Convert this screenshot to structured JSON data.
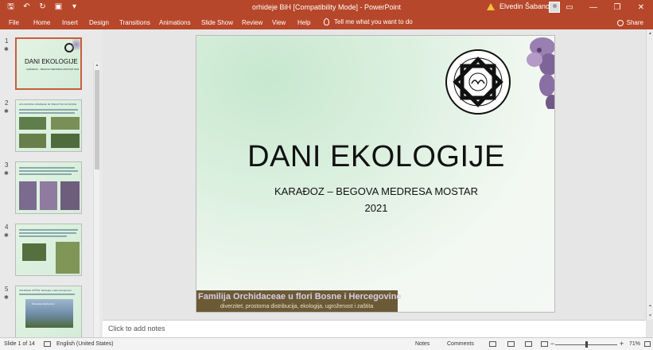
{
  "titlebar": {
    "doc_title": "orhideje BiH [Compatibility Mode]  -  PowerPoint",
    "user_name": "Elvedin Šabanović",
    "window_controls": {
      "minimize": "—",
      "restore": "❐",
      "close": "✕",
      "ribbon_options": "▭"
    },
    "qat_icons": [
      "save-icon",
      "undo-icon",
      "redo-icon",
      "present-icon",
      "customize-icon"
    ]
  },
  "ribbon": {
    "tabs": [
      "File",
      "Home",
      "Insert",
      "Design",
      "Transitions",
      "Animations",
      "Slide Show",
      "Review",
      "View",
      "Help"
    ],
    "tell_me": "Tell me what you want to do",
    "share": "Share"
  },
  "thumbnails": [
    {
      "num": "1",
      "title": "DANI EKOLOGIJE",
      "subtitle": "KARAĐOZ – BEGOVA MEDRESA MOSTAR 2021"
    },
    {
      "num": "2",
      "header": "HOLANDSKE ORHIDEJE JE TRENUTNO NA RUSKE"
    },
    {
      "num": "3"
    },
    {
      "num": "4"
    },
    {
      "num": "5",
      "header": "ORHIDEJE OPŠTE: Ekologija i rasprostranjenost",
      "caption": "Meseljeka Ilijahovaca"
    }
  ],
  "slide": {
    "title": "DANI EKOLOGIJE",
    "subtitle": "KARAĐOZ – BEGOVA MEDRESA MOSTAR",
    "year": "2021",
    "banner_title": "Familija Orchidaceae u flori Bosne i Hercegovine",
    "banner_sub": "diverzitet, prostorna distribucija, ekologija, ugroženost i zaštita"
  },
  "notes": {
    "placeholder": "Click to add notes"
  },
  "statusbar": {
    "slide_info": "Slide 1 of 14",
    "language": "English (United States)",
    "notes_label": "Notes",
    "comments_label": "Comments",
    "zoom": "71%"
  }
}
